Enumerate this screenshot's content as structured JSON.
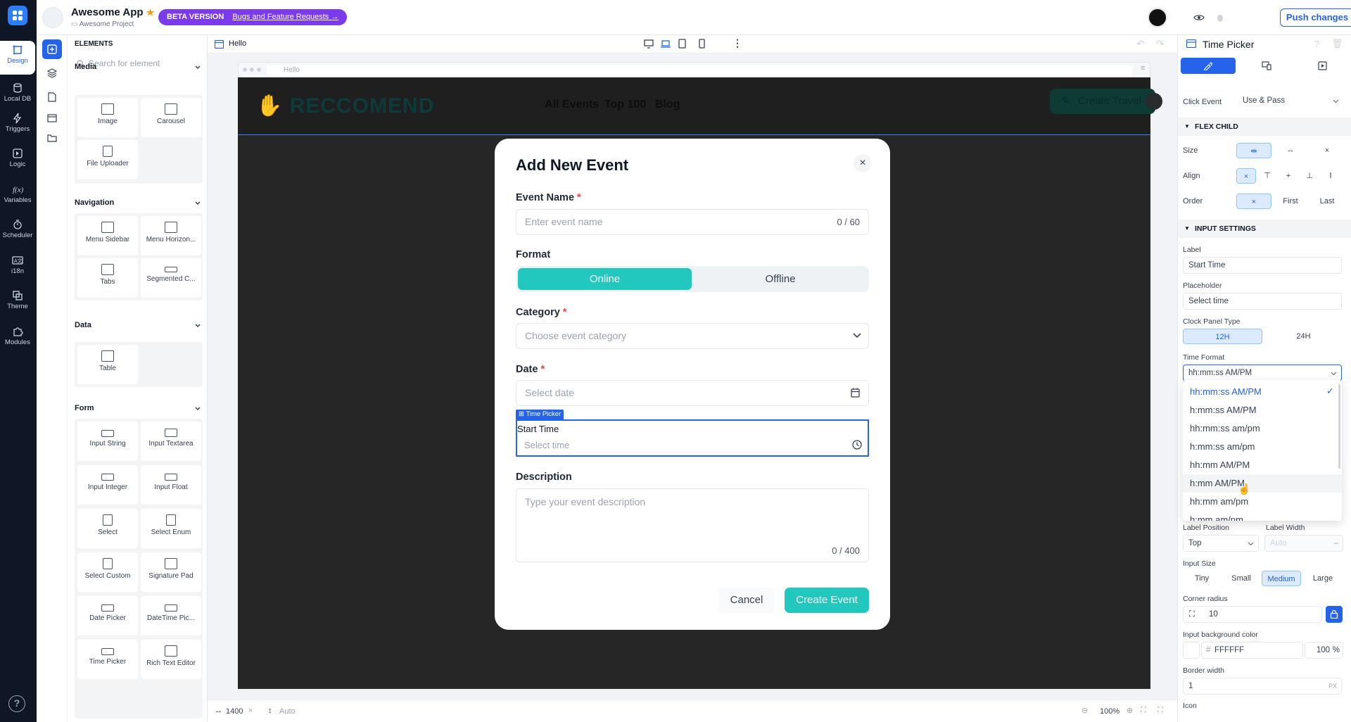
{
  "rail": {
    "items": [
      {
        "label": "Design"
      },
      {
        "label": "Local DB"
      },
      {
        "label": "Triggers"
      },
      {
        "label": "Logic"
      },
      {
        "label": "Variables"
      },
      {
        "label": "Scheduler"
      },
      {
        "label": "i18n"
      },
      {
        "label": "Theme"
      },
      {
        "label": "Modules"
      }
    ]
  },
  "topbar": {
    "app_name": "Awesome App",
    "project": "Awesome Project",
    "beta_label": "BETA VERSION",
    "beta_link": "Bugs and Feature Requests →",
    "push_label": "Push changes"
  },
  "elements": {
    "title": "ELEMENTS",
    "search_placeholder": "Search for element",
    "sections": [
      {
        "title": "Media",
        "items": [
          "Image",
          "Carousel",
          "File Uploader"
        ]
      },
      {
        "title": "Navigation",
        "items": [
          "Menu Sidebar",
          "Menu Horizon...",
          "Tabs",
          "Segmented C..."
        ]
      },
      {
        "title": "Data",
        "items": [
          "Table"
        ]
      },
      {
        "title": "Form",
        "items": [
          "Input String",
          "Input Textarea",
          "Input Integer",
          "Input Float",
          "Select",
          "Select Enum",
          "Select Custom",
          "Signature Pad",
          "Date Picker",
          "DateTime Pic...",
          "Time Picker",
          "Rich Text Editor"
        ]
      }
    ]
  },
  "canvas": {
    "page_name": "Hello",
    "browser_url": "Hello",
    "width_value": "1400",
    "height_value": "Auto",
    "zoom": "100%"
  },
  "site": {
    "brand": "RECCOMEND",
    "nav": [
      "All Events",
      "Top 100",
      "Blog"
    ],
    "cta": "Create Travel"
  },
  "modal": {
    "title": "Add New Event",
    "event_name_label": "Event Name",
    "event_name_placeholder": "Enter event name",
    "event_name_count": "0 / 60",
    "format_label": "Format",
    "format_on": "Online",
    "format_off": "Offline",
    "category_label": "Category",
    "category_placeholder": "Choose event category",
    "date_label": "Date",
    "date_placeholder": "Select date",
    "timepicker_tag": "Time Picker",
    "start_time_label": "Start Time",
    "time_placeholder": "Select time",
    "description_label": "Description",
    "description_placeholder": "Type your event description",
    "description_count": "0 / 400",
    "cancel_label": "Cancel",
    "create_label": "Create Event",
    "required_mark": "*"
  },
  "props": {
    "title": "Time Picker",
    "click_event_label": "Click Event",
    "click_event_value": "Use & Pass",
    "flex_child": "FLEX CHILD",
    "size_label": "Size",
    "align_label": "Align",
    "order_label": "Order",
    "order_first": "First",
    "order_last": "Last",
    "input_settings": "INPUT SETTINGS",
    "label_label": "Label",
    "label_value": "Start Time",
    "placeholder_label": "Placeholder",
    "placeholder_value": "Select time",
    "clock_panel_label": "Clock Panel Type",
    "clock_12": "12H",
    "clock_24": "24H",
    "time_format_label": "Time Format",
    "time_format_value": "hh:mm:ss AM/PM",
    "time_format_options": [
      "hh:mm:ss AM/PM",
      "h:mm:ss AM/PM",
      "hh:mm:ss am/pm",
      "h:mm:ss am/pm",
      "hh:mm AM/PM",
      "h:mm AM/PM",
      "hh:mm am/pm",
      "h:mm am/pm"
    ],
    "label_position_label": "Label Position",
    "label_position_value": "Top",
    "label_width_label": "Label Width",
    "label_width_value": "Auto",
    "input_size_label": "Input Size",
    "sizes": [
      "Tiny",
      "Small",
      "Medium",
      "Large"
    ],
    "corner_radius_label": "Corner radius",
    "corner_radius_value": "10",
    "bg_color_label": "Input background color",
    "bg_color_value": "FFFFFF",
    "bg_opacity": "100",
    "bg_opacity_unit": "%",
    "border_width_label": "Border width",
    "border_width_value": "1",
    "border_width_unit": "PX",
    "icon_label": "Icon"
  },
  "colors": {
    "accent": "#2563eb",
    "teal": "#22c7be",
    "beta": "#7c3aed"
  }
}
